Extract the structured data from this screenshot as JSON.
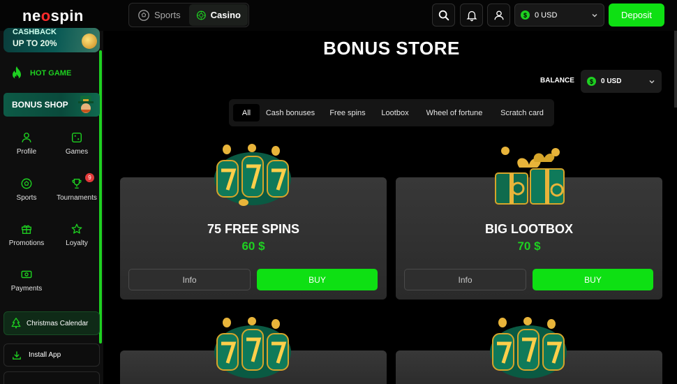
{
  "header": {
    "logo": {
      "ne": "ne",
      "o": "o",
      "spin": "spin"
    },
    "modes": [
      {
        "label": "Sports",
        "icon": "soccer-ball-icon",
        "active": false
      },
      {
        "label": "Casino",
        "icon": "casino-chip-icon",
        "active": true
      }
    ],
    "icons": [
      "search-icon",
      "bell-icon",
      "user-icon"
    ],
    "balance": {
      "amount": "0 USD",
      "currency_symbol": "$"
    },
    "deposit_label": "Deposit"
  },
  "sidebar": {
    "cashback": {
      "line1": "CASHBACK",
      "line2": "UP TO 20%"
    },
    "hot_game": "HOT GAME",
    "bonus_shop": "BONUS SHOP",
    "nav": [
      {
        "label": "Profile",
        "icon": "user-icon"
      },
      {
        "label": "Games",
        "icon": "dice-icon"
      },
      {
        "label": "Sports",
        "icon": "soccer-ball-icon"
      },
      {
        "label": "Tournaments",
        "icon": "trophy-icon",
        "badge": "9"
      },
      {
        "label": "Promotions",
        "icon": "gift-icon"
      },
      {
        "label": "Loyalty",
        "icon": "star-icon"
      },
      {
        "label": "Payments",
        "icon": "money-icon"
      }
    ],
    "christmas_calendar": "Christmas Calendar",
    "install_app": "Install App"
  },
  "main": {
    "title": "BONUS STORE",
    "balance_label": "BALANCE",
    "balance_value": "0 USD",
    "currency_symbol": "$",
    "filters": [
      {
        "label": "All",
        "active": true
      },
      {
        "label": "Cash bonuses",
        "active": false
      },
      {
        "label": "Free spins",
        "active": false
      },
      {
        "label": "Lootbox",
        "active": false
      },
      {
        "label": "Wheel of fortune",
        "active": false
      },
      {
        "label": "Scratch card",
        "active": false
      }
    ],
    "cards": [
      {
        "title": "75 FREE SPINS",
        "price": "60 $",
        "info_label": "Info",
        "buy_label": "BUY",
        "art": "slot-777-icon"
      },
      {
        "title": "BIG LOOTBOX",
        "price": "70 $",
        "info_label": "Info",
        "buy_label": "BUY",
        "art": "gift-box-icon"
      }
    ],
    "next_cards_art": [
      "slot-777-icon",
      "slot-777-icon"
    ]
  },
  "colors": {
    "accent_green": "#0ee013",
    "price_green": "#1ed021",
    "badge_red": "#e23a3a",
    "card_bg": "#2f2f2f"
  }
}
